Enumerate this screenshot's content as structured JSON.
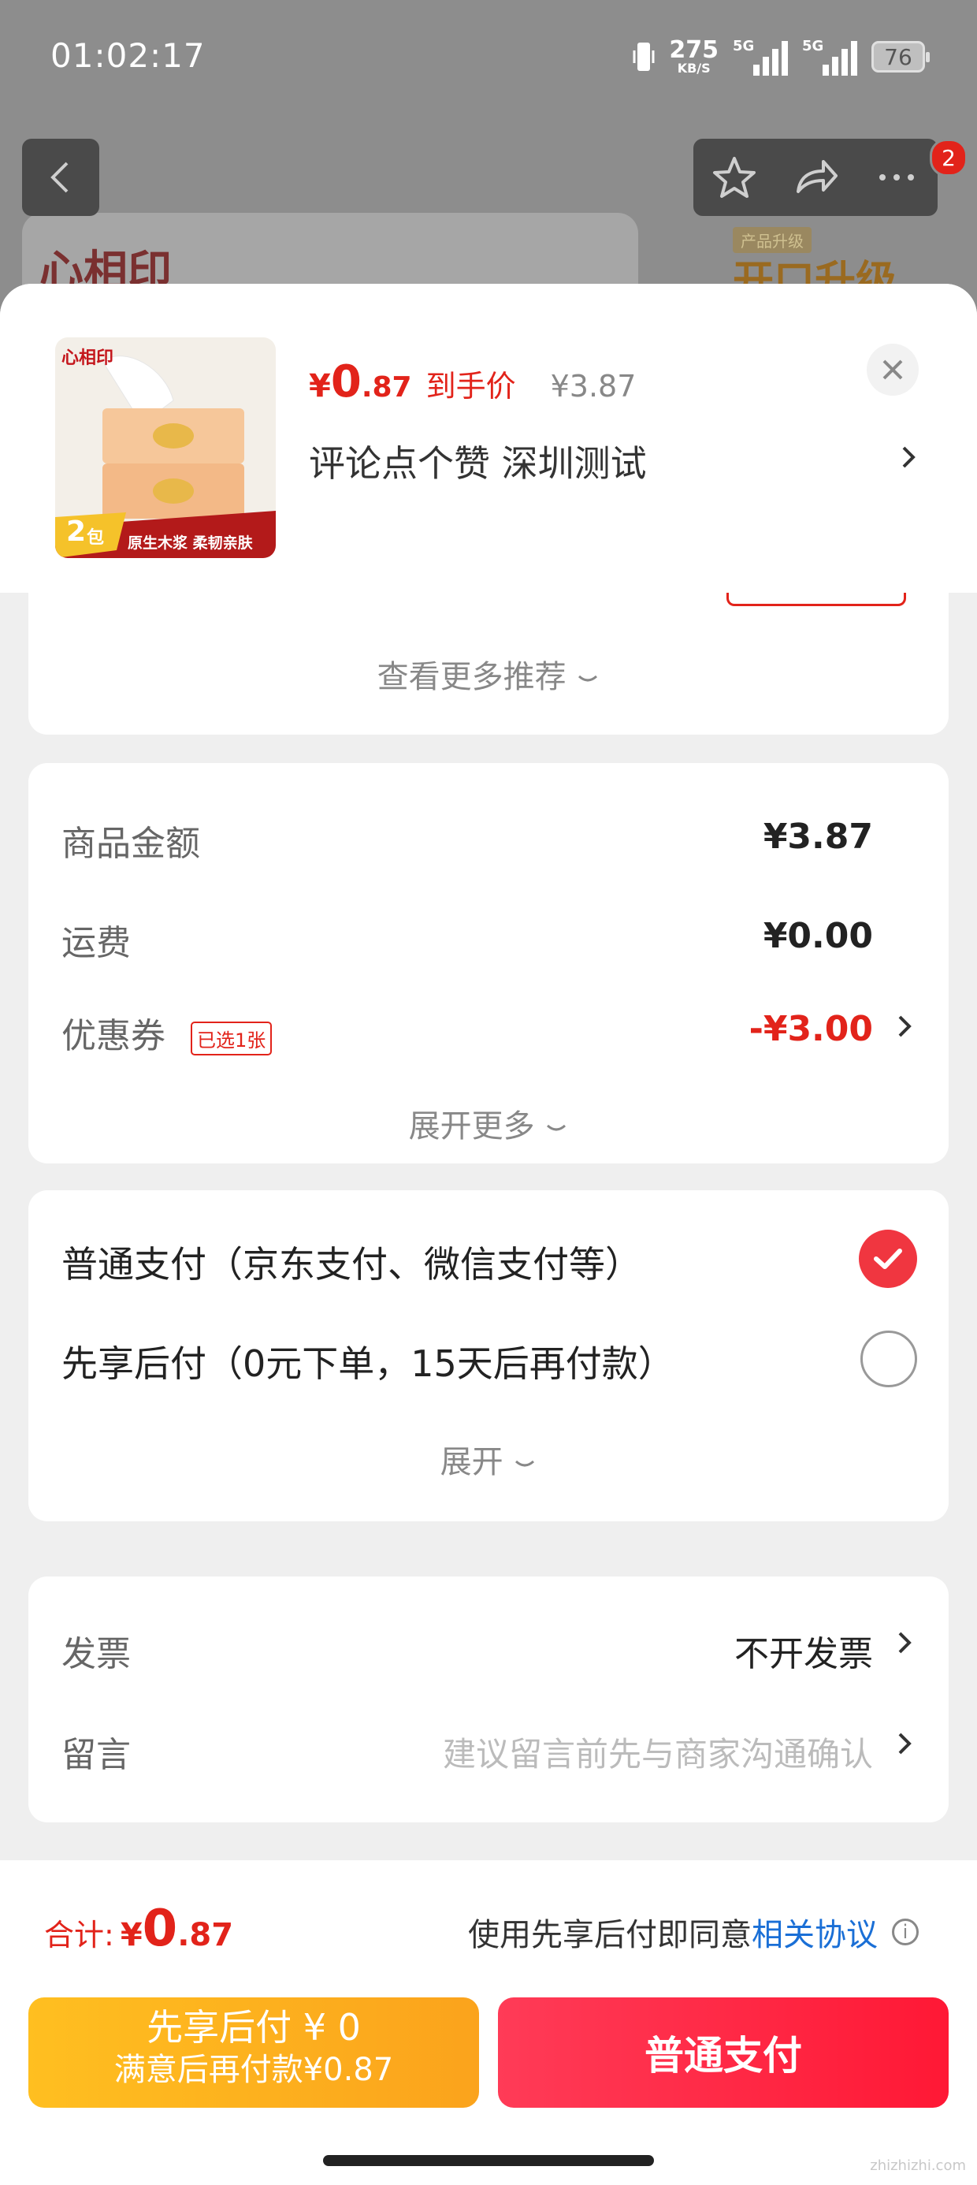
{
  "status_bar": {
    "time": "01:02:17",
    "net_speed": "275",
    "net_unit": "KB/S",
    "sig1_label": "5G",
    "sig2_label": "5G",
    "battery": "76"
  },
  "background_page": {
    "brand": "心相印",
    "promo_tag": "产品升级",
    "promo_big": "开口升级",
    "cart_badge": "2"
  },
  "sheet": {
    "price_yen": "¥",
    "price_int": "0",
    "price_dec": ".87",
    "price_label": "到手价",
    "original_price": "¥3.87",
    "spec": "评论点个赞  深圳测试",
    "thumb": {
      "brand": "心相印",
      "count": "2",
      "count_unit": "包",
      "slogan": "原生木浆 柔韧亲肤"
    }
  },
  "recommend": {
    "more_label": "查看更多推荐"
  },
  "amounts": {
    "goods_label": "商品金额",
    "goods_value": "¥3.87",
    "shipping_label": "运费",
    "shipping_value": "¥0.00",
    "coupon_label": "优惠券",
    "coupon_tag": "已选1张",
    "coupon_value": "-¥3.00",
    "expand_label": "展开更多"
  },
  "payment": {
    "option1": "普通支付（京东支付、微信支付等）",
    "option2": "先享后付（0元下单，15天后再付款）",
    "expand_label": "展开"
  },
  "extras": {
    "invoice_label": "发票",
    "invoice_value": "不开发票",
    "message_label": "留言",
    "message_placeholder": "建议留言前先与商家沟通确认"
  },
  "bottom": {
    "total_label": "合计:",
    "total_yen": "¥",
    "total_int": "0",
    "total_dec": ".87",
    "agree_text": "使用先享后付即同意",
    "agree_link": "相关协议",
    "bnpl_line1": "先享后付 ¥ 0",
    "bnpl_line2": "满意后再付款¥0.87",
    "pay_button": "普通支付",
    "watermark": "zhizhizhi.com"
  },
  "colors": {
    "accent_red": "#e2231a",
    "pay_button": "#ff2a45",
    "bnpl_button": "#fbb21e",
    "link_blue": "#1a6fd6"
  }
}
